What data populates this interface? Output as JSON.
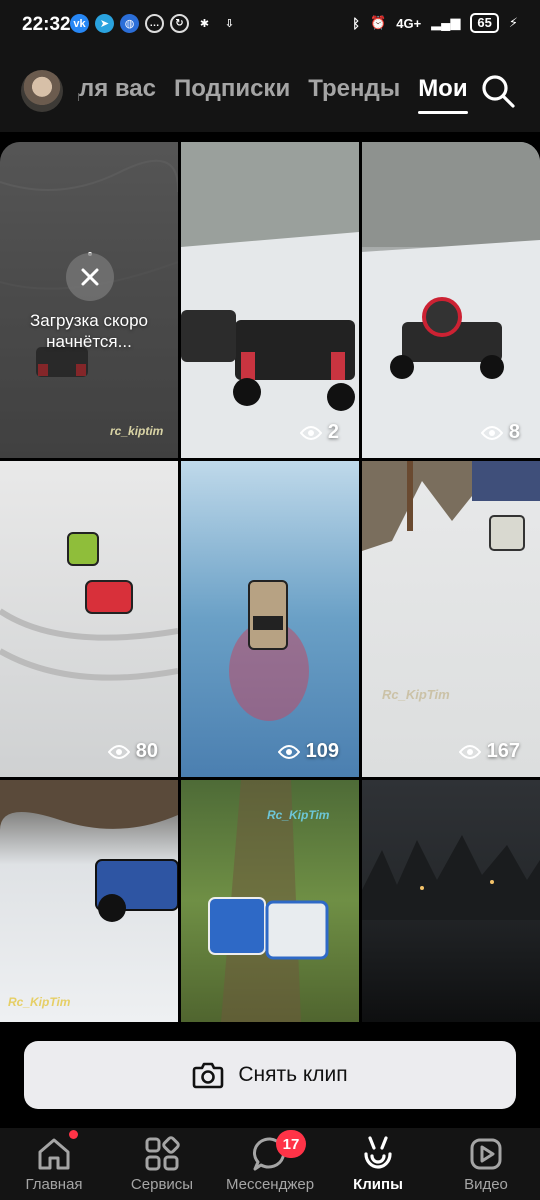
{
  "status_bar": {
    "time": "22:32",
    "battery": "65",
    "network": "4G+"
  },
  "header": {
    "tabs": [
      {
        "label": "Для вас",
        "active": false
      },
      {
        "label": "Подписки",
        "active": false
      },
      {
        "label": "Тренды",
        "active": false
      },
      {
        "label": "Мои",
        "active": true
      }
    ]
  },
  "clips": [
    {
      "uploading": true,
      "upload_text": "Загрузка скоро начнётся...",
      "watermark": "rc_kiptim"
    },
    {
      "views": "2"
    },
    {
      "views": "8"
    },
    {
      "views": "80"
    },
    {
      "views": "109"
    },
    {
      "views": "167",
      "watermark": "Rc_KipTim"
    },
    {
      "watermark": "Rc_KipTim"
    },
    {
      "watermark": "Rc_KipTim"
    },
    {}
  ],
  "capture_button": {
    "label": "Снять клип",
    "icon": "camera-icon"
  },
  "bottom_nav": [
    {
      "label": "Главная",
      "icon": "home-icon",
      "badge_dot": true
    },
    {
      "label": "Сервисы",
      "icon": "services-icon"
    },
    {
      "label": "Мессенджер",
      "icon": "messenger-icon",
      "badge": "17"
    },
    {
      "label": "Клипы",
      "icon": "clips-icon",
      "active": true
    },
    {
      "label": "Видео",
      "icon": "video-icon"
    }
  ],
  "colors": {
    "background": "#000000",
    "bar": "#141414",
    "accent_badge": "#ff3347",
    "inactive_text": "#a5a5a5",
    "button_bg": "#ececef"
  }
}
